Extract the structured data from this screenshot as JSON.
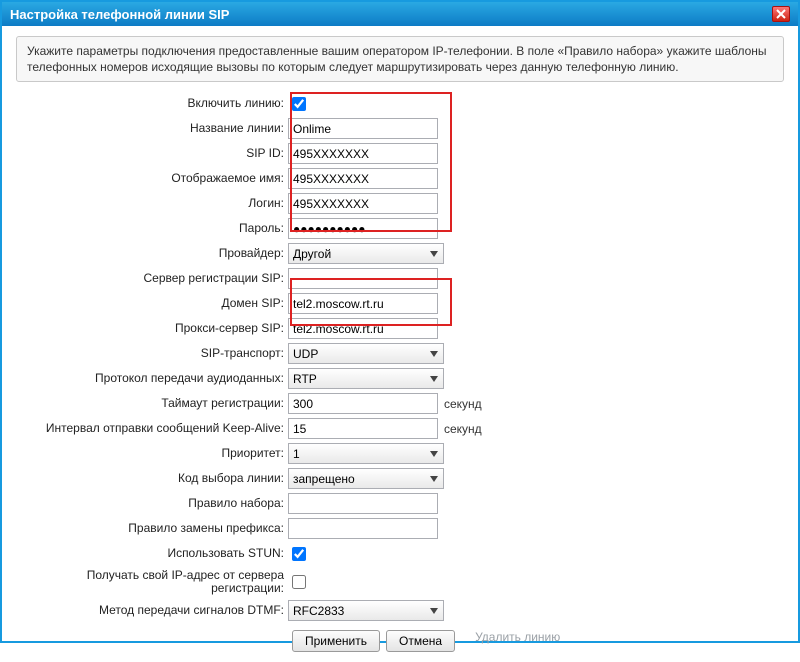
{
  "window": {
    "title": "Настройка телефонной линии SIP"
  },
  "info": "Укажите параметры подключения предоставленные вашим оператором IP-телефонии. В поле «Правило набора» укажите шаблоны телефонных номеров исходящие вызовы по которым следует маршрутизировать через данную телефонную линию.",
  "labels": {
    "enable": "Включить линию:",
    "name": "Название линии:",
    "sipid": "SIP ID:",
    "display": "Отображаемое имя:",
    "login": "Логин:",
    "password": "Пароль:",
    "provider": "Провайдер:",
    "regserver": "Сервер регистрации SIP:",
    "domain": "Домен SIP:",
    "proxy": "Прокси-сервер SIP:",
    "transport": "SIP-транспорт:",
    "audio": "Протокол передачи аудиоданных:",
    "regtimeout": "Таймаут регистрации:",
    "keepalive": "Интервал отправки сообщений Keep-Alive:",
    "priority": "Приоритет:",
    "linecode": "Код выбора линии:",
    "dialrule": "Правило набора:",
    "prefix": "Правило замены префикса:",
    "stun": "Использовать STUN:",
    "getip": "Получать свой IP-адрес от сервера регистрации:",
    "dtmf": "Метод передачи сигналов DTMF:"
  },
  "values": {
    "enable": true,
    "name": "Onlime",
    "sipid": "495XXXXXXX",
    "display": "495XXXXXXX",
    "login": "495XXXXXXX",
    "password": "●●●●●●●●●●",
    "provider": "Другой",
    "regserver": "",
    "domain": "tel2.moscow.rt.ru",
    "proxy": "tel2.moscow.rt.ru",
    "transport": "UDP",
    "audio": "RTP",
    "regtimeout": "300",
    "keepalive": "15",
    "priority": "1",
    "linecode": "запрещено",
    "dialrule": "",
    "prefix": "",
    "stun": true,
    "getip": false,
    "dtmf": "RFC2833"
  },
  "units": {
    "seconds": "секунд"
  },
  "buttons": {
    "apply": "Применить",
    "cancel": "Отмена",
    "delete": "Удалить линию"
  }
}
